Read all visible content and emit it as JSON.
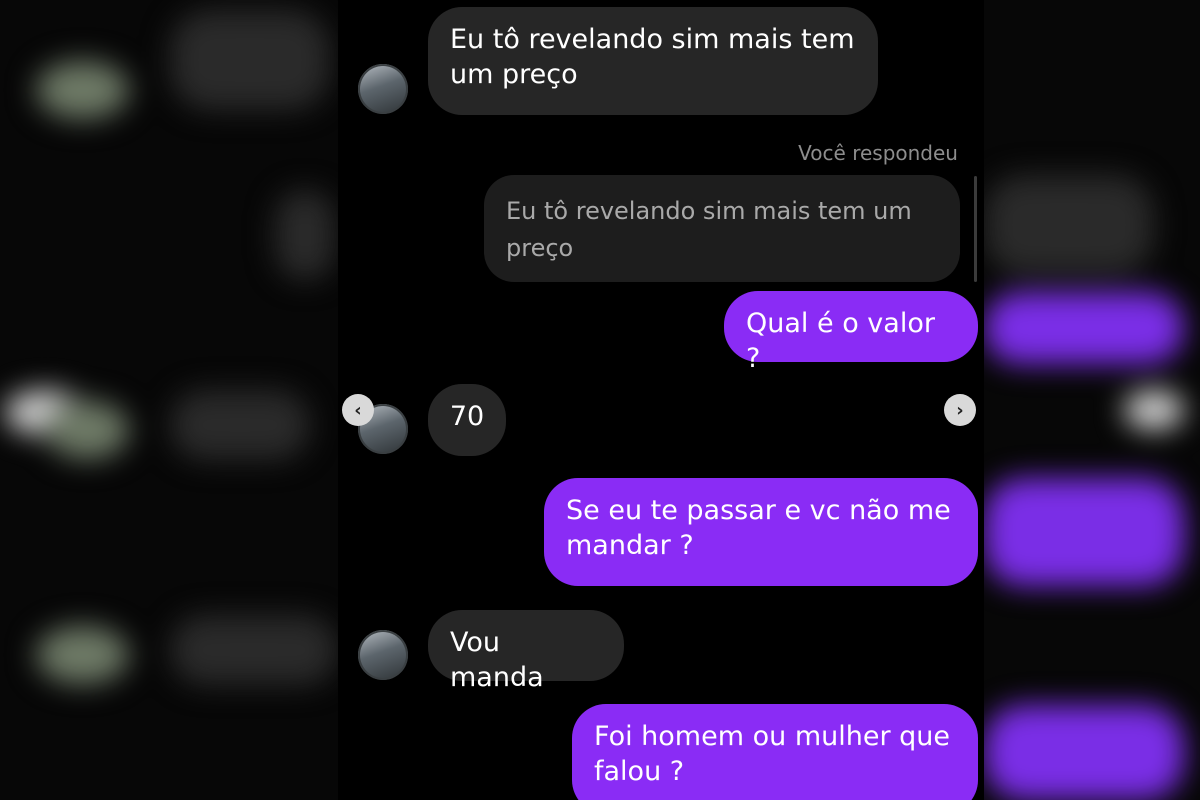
{
  "thread": {
    "reply_label": "Você respondeu",
    "messages": [
      {
        "id": "m1",
        "direction": "incoming",
        "text": "Eu tô revelando sim mais tem um preço"
      },
      {
        "id": "m2",
        "direction": "quote",
        "text": "Eu tô revelando sim mais tem um preço"
      },
      {
        "id": "m3",
        "direction": "outgoing",
        "text": "Qual é o valor ?"
      },
      {
        "id": "m4",
        "direction": "incoming",
        "text": "70"
      },
      {
        "id": "m5",
        "direction": "outgoing",
        "text": "Se eu te passar e vc não me mandar ?"
      },
      {
        "id": "m6",
        "direction": "incoming",
        "text": "Vou manda"
      },
      {
        "id": "m7",
        "direction": "outgoing",
        "text": "Foi homem ou mulher que falou ?"
      }
    ]
  },
  "navigation": {
    "prev_icon": "chevron-left",
    "next_icon": "chevron-right",
    "prev_glyph": "‹",
    "next_glyph": "›"
  },
  "colors": {
    "background": "#000000",
    "incoming_bubble": "#262626",
    "outgoing_bubble": "#8a2cf5",
    "quote_bubble": "#1d1d1d",
    "muted_text": "#8d8d8d"
  }
}
